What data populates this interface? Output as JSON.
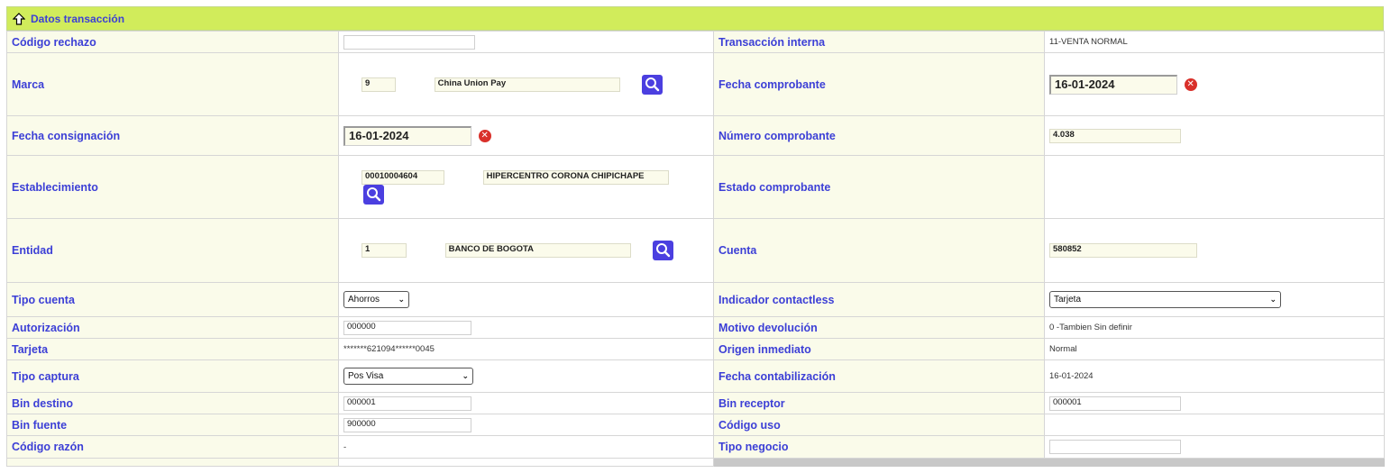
{
  "header": {
    "title": "Datos transacción"
  },
  "rows": {
    "codigo_rechazo": {
      "label": "Código rechazo",
      "value": ""
    },
    "transaccion_interna": {
      "label": "Transacción interna",
      "value": "11-VENTA NORMAL"
    },
    "marca": {
      "label": "Marca",
      "code": "9",
      "name": "China Union Pay"
    },
    "fecha_comprobante": {
      "label": "Fecha comprobante",
      "value": "16-01-2024"
    },
    "fecha_consignacion": {
      "label": "Fecha consignación",
      "value": "16-01-2024"
    },
    "numero_comprobante": {
      "label": "Número comprobante",
      "value": "4.038"
    },
    "establecimiento": {
      "label": "Establecimiento",
      "code": "00010004604",
      "name": "HIPERCENTRO CORONA CHIPICHAPE"
    },
    "estado_comprobante": {
      "label": "Estado comprobante",
      "value": ""
    },
    "entidad": {
      "label": "Entidad",
      "code": "1",
      "name": "BANCO DE BOGOTA"
    },
    "cuenta": {
      "label": "Cuenta",
      "value": "580852"
    },
    "tipo_cuenta": {
      "label": "Tipo cuenta",
      "selected": "Ahorros"
    },
    "indicador_contactless": {
      "label": "Indicador contactless",
      "selected": "Tarjeta"
    },
    "autorizacion": {
      "label": "Autorización",
      "value": "000000"
    },
    "motivo_devolucion": {
      "label": "Motivo devolución",
      "value": "0 -Tambien Sin definir"
    },
    "tarjeta": {
      "label": "Tarjeta",
      "value": "*******621094******0045"
    },
    "origen_inmediato": {
      "label": "Origen inmediato",
      "value": "Normal"
    },
    "tipo_captura": {
      "label": "Tipo captura",
      "selected": "Pos Visa"
    },
    "fecha_contabilizacion": {
      "label": "Fecha contabilización",
      "value": "16-01-2024"
    },
    "bin_destino": {
      "label": "Bin destino",
      "value": "000001"
    },
    "bin_receptor": {
      "label": "Bin receptor",
      "value": "000001"
    },
    "bin_fuente": {
      "label": "Bin fuente",
      "value": "900000"
    },
    "codigo_uso": {
      "label": "Código uso",
      "value": ""
    },
    "codigo_razon": {
      "label": "Código razón",
      "value": "-"
    },
    "tipo_negocio": {
      "label": "Tipo negocio",
      "value": ""
    }
  },
  "icons": {
    "collapse": "arrow-up-icon",
    "search": "search-icon",
    "clear": "clear-date-icon",
    "select": "chevron-down-icon"
  },
  "colors": {
    "header_bg": "#d1ec5b",
    "label_text": "#3c3fd6",
    "label_bg": "#fafbea",
    "search_button": "#4b3fe0",
    "clear_button": "#d9302a"
  }
}
